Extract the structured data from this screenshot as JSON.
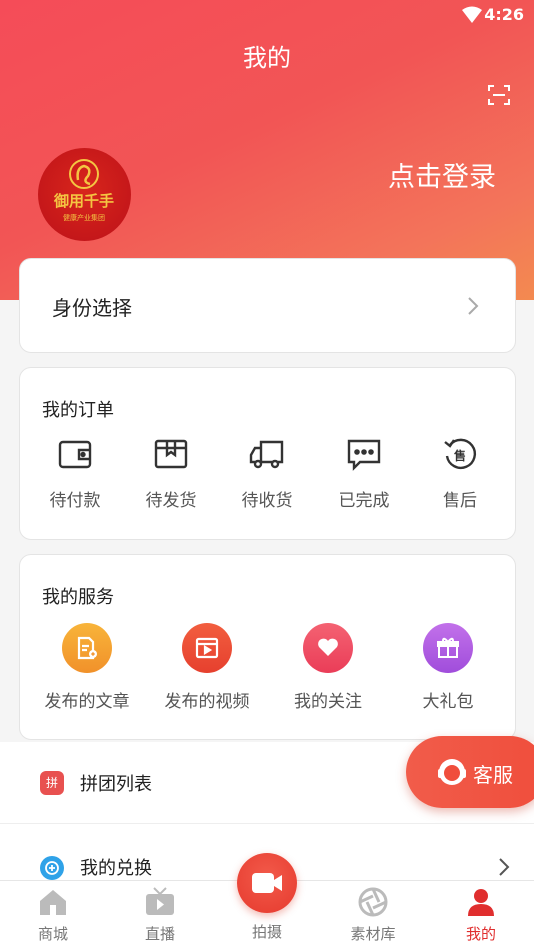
{
  "status_bar": {
    "time": "4:26"
  },
  "header": {
    "title": "我的",
    "login_label": "点击登录",
    "avatar_logo_text": "御用千手",
    "avatar_logo_sub": "健康产业集团"
  },
  "identity": {
    "label": "身份选择"
  },
  "orders": {
    "title": "我的订单",
    "items": [
      {
        "label": "待付款",
        "icon": "wallet-icon"
      },
      {
        "label": "待发货",
        "icon": "package-icon"
      },
      {
        "label": "待收货",
        "icon": "truck-icon"
      },
      {
        "label": "已完成",
        "icon": "message-dots-icon"
      },
      {
        "label": "售后",
        "icon": "after-sale-icon"
      }
    ]
  },
  "services": {
    "title": "我的服务",
    "items": [
      {
        "label": "发布的文章",
        "icon": "article-icon",
        "color": "#f5a22a"
      },
      {
        "label": "发布的视频",
        "icon": "video-icon",
        "color": "#ee4b35"
      },
      {
        "label": "我的关注",
        "icon": "heart-icon",
        "color": "#ef4d66"
      },
      {
        "label": "大礼包",
        "icon": "gift-icon",
        "color": "#b35fe3"
      }
    ]
  },
  "list": {
    "group_buy": {
      "label": "拼团列表",
      "icon": "group-buy-icon",
      "icon_char": "拼"
    },
    "exchange": {
      "label": "我的兑换",
      "icon": "exchange-icon"
    }
  },
  "customer_service": {
    "label": "客服"
  },
  "tabbar": {
    "items": [
      {
        "label": "商城",
        "icon": "home-icon"
      },
      {
        "label": "直播",
        "icon": "tv-icon"
      },
      {
        "label": "拍摄",
        "icon": "camera-icon"
      },
      {
        "label": "素材库",
        "icon": "aperture-icon"
      },
      {
        "label": "我的",
        "icon": "user-icon",
        "active": true
      }
    ]
  },
  "colors": {
    "accent": "#e02e2e",
    "header_start": "#f54c58",
    "header_end": "#f38a50"
  }
}
